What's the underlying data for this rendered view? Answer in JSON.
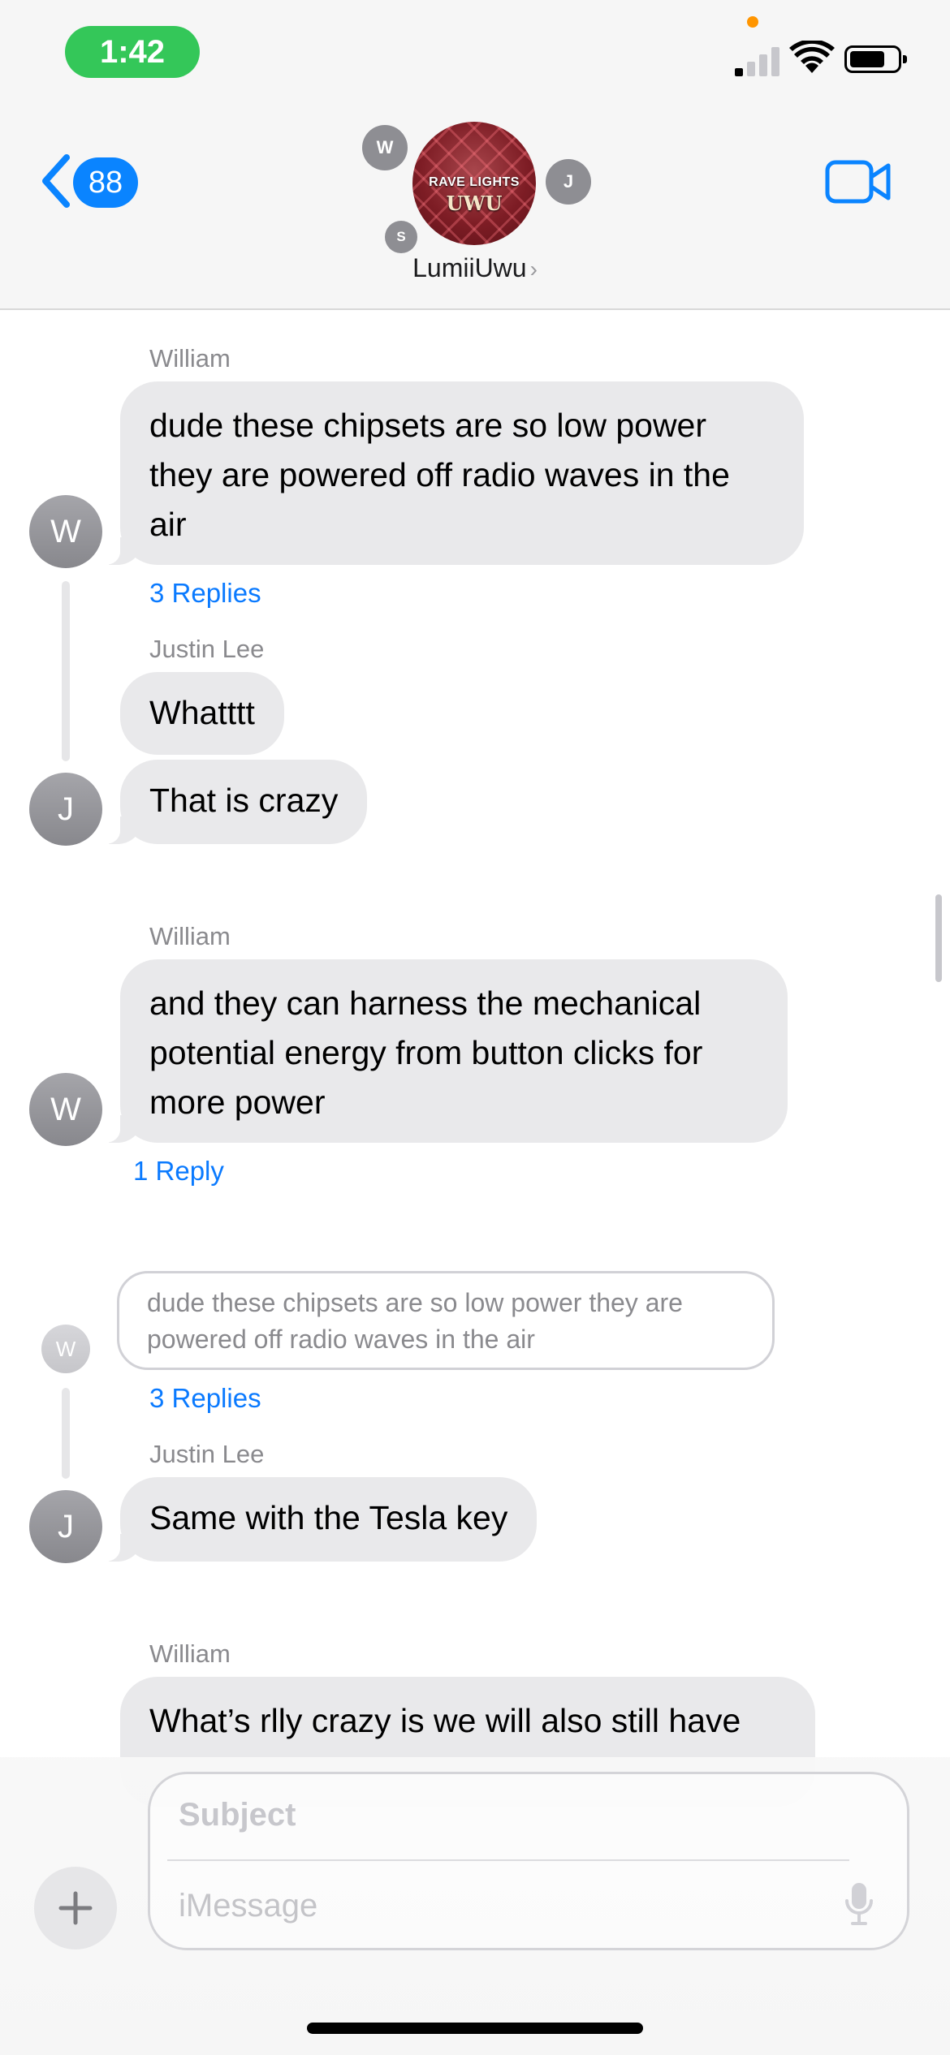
{
  "status_bar": {
    "time": "1:42",
    "colors": {
      "time_pill": "#34c759",
      "privacy_dot": "#ff9500"
    }
  },
  "header": {
    "back_count": "88",
    "group_name": "LumiiUwu",
    "group_photo_text_1": "RAVE LIGHTS",
    "group_photo_text_2": "UWU",
    "member_initials": [
      "W",
      "J",
      "S"
    ],
    "accent_color": "#0a84ff",
    "icons": [
      "chevron-left-icon",
      "video-camera-icon",
      "chevron-right-icon"
    ]
  },
  "messages": [
    {
      "sender": "William",
      "avatar_initial": "W",
      "text": "dude these chipsets are so low power they are powered off radio waves in the air",
      "thread_replies": "3 Replies"
    },
    {
      "sender": "Justin Lee",
      "avatar_initial": "J",
      "bubbles": [
        "Whatttt",
        "That is crazy"
      ]
    },
    {
      "sender": "William",
      "avatar_initial": "W",
      "text": "and they can harness the mechanical potential energy from button clicks for more power",
      "thread_replies": "1 Reply"
    },
    {
      "quoted_avatar_initial": "W",
      "quoted_text": "dude these chipsets are so low power they are powered off radio waves in the air",
      "thread_replies": "3 Replies"
    },
    {
      "sender": "Justin Lee",
      "avatar_initial": "J",
      "text": "Same with the Tesla key"
    },
    {
      "sender": "William",
      "text": "What’s rlly crazy is we will also still have"
    }
  ],
  "composer": {
    "subject_placeholder": "Subject",
    "message_placeholder": "iMessage",
    "icons": [
      "plus-icon",
      "microphone-icon"
    ]
  }
}
